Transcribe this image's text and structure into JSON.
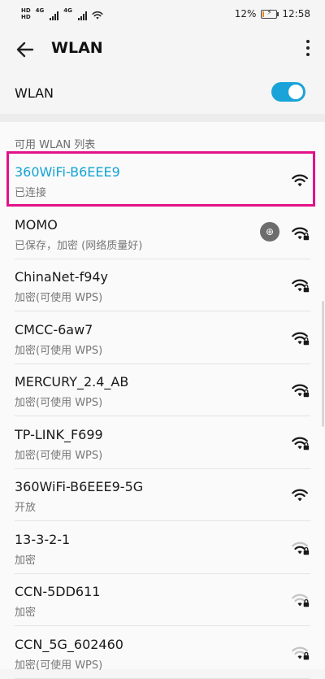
{
  "status_bar": {
    "left_badges": [
      "HD",
      "HD",
      "4G",
      "4G"
    ],
    "battery_percent": "12%",
    "time": "12:58"
  },
  "app_bar": {
    "title": "WLAN",
    "back_icon": "back-arrow-icon",
    "more_icon": "more-vertical-icon"
  },
  "wlan_toggle": {
    "label": "WLAN",
    "enabled": true
  },
  "section_label": "可用 WLAN 列表",
  "networks": [
    {
      "name": "360WiFi-B6EEE9",
      "status": "已连接",
      "connected": true,
      "locked": false,
      "strength": "full"
    },
    {
      "name": "MOMO",
      "status": "已保存，加密 (网络质量好)",
      "connected": false,
      "locked": true,
      "strength": "full",
      "extra_icon": "hms-icon"
    },
    {
      "name": "ChinaNet-f94y",
      "status": "加密(可使用 WPS)",
      "connected": false,
      "locked": true,
      "strength": "full"
    },
    {
      "name": "CMCC-6aw7",
      "status": "加密(可使用 WPS)",
      "connected": false,
      "locked": true,
      "strength": "full"
    },
    {
      "name": "MERCURY_2.4_AB",
      "status": "加密(可使用 WPS)",
      "connected": false,
      "locked": true,
      "strength": "full"
    },
    {
      "name": "TP-LINK_F699",
      "status": "加密(可使用 WPS)",
      "connected": false,
      "locked": true,
      "strength": "full"
    },
    {
      "name": "360WiFi-B6EEE9-5G",
      "status": "开放",
      "connected": false,
      "locked": false,
      "strength": "full"
    },
    {
      "name": "13-3-2-1",
      "status": "加密",
      "connected": false,
      "locked": true,
      "strength": "medium"
    },
    {
      "name": "CCN-5DD611",
      "status": "加密",
      "connected": false,
      "locked": true,
      "strength": "low"
    },
    {
      "name": "CCN_5G_602460",
      "status": "加密(可使用 WPS)",
      "connected": false,
      "locked": true,
      "strength": "low"
    }
  ],
  "colors": {
    "accent": "#12a3d4",
    "switch_on": "#1aa3d9",
    "highlight_border": "#e3118a",
    "text_primary": "#1a1a1a",
    "text_secondary": "#777777"
  }
}
